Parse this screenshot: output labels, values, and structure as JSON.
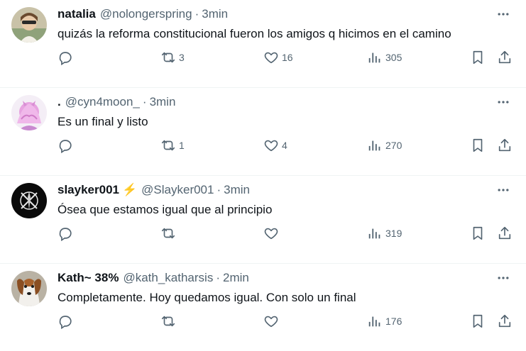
{
  "tweets": [
    {
      "name": "natalia",
      "emoji": "",
      "handle": "@nolongerspring",
      "separator": "·",
      "time": "3min",
      "text": "quizás la reforma constitucional fueron los amigos q hicimos en el camino",
      "replies": "",
      "retweets": "3",
      "likes": "16",
      "views": "305"
    },
    {
      "name": ".",
      "emoji": "",
      "handle": "@cyn4moon_",
      "separator": "·",
      "time": "3min",
      "text": "Es un final y listo",
      "replies": "",
      "retweets": "1",
      "likes": "4",
      "views": "270"
    },
    {
      "name": "slayker001",
      "emoji": "⚡",
      "handle": "@Slayker001",
      "separator": "·",
      "time": "3min",
      "text": "Ósea que estamos igual que al principio",
      "replies": "",
      "retweets": "",
      "likes": "",
      "views": "319"
    },
    {
      "name": "Kath~ 38%",
      "emoji": "",
      "handle": "@kath_katharsis",
      "separator": "·",
      "time": "2min",
      "text": "Completamente. Hoy quedamos igual. Con solo un final",
      "replies": "",
      "retweets": "",
      "likes": "",
      "views": "176"
    }
  ],
  "colors": {
    "text": "#0f1419",
    "secondary": "#536471",
    "border": "#eff3f4",
    "lightning": "#f5a623"
  }
}
